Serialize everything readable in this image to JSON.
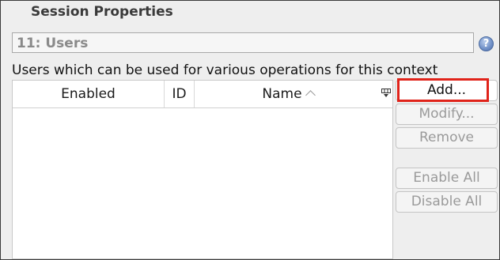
{
  "dialog": {
    "title": "Session Properties"
  },
  "panel": {
    "heading": "11: Users",
    "description": "Users which can be used for various operations for this context"
  },
  "help": {
    "icon": "help-icon",
    "glyph": "?"
  },
  "table": {
    "columns": [
      "Enabled",
      "ID",
      "Name"
    ],
    "sort_column": "Name",
    "sort_direction": "ascending",
    "rows": []
  },
  "actions": {
    "add_label": "Add...",
    "modify_label": "Modify...",
    "remove_label": "Remove",
    "enable_all_label": "Enable All",
    "disable_all_label": "Disable All"
  },
  "colors": {
    "highlight": "#e0231a"
  }
}
